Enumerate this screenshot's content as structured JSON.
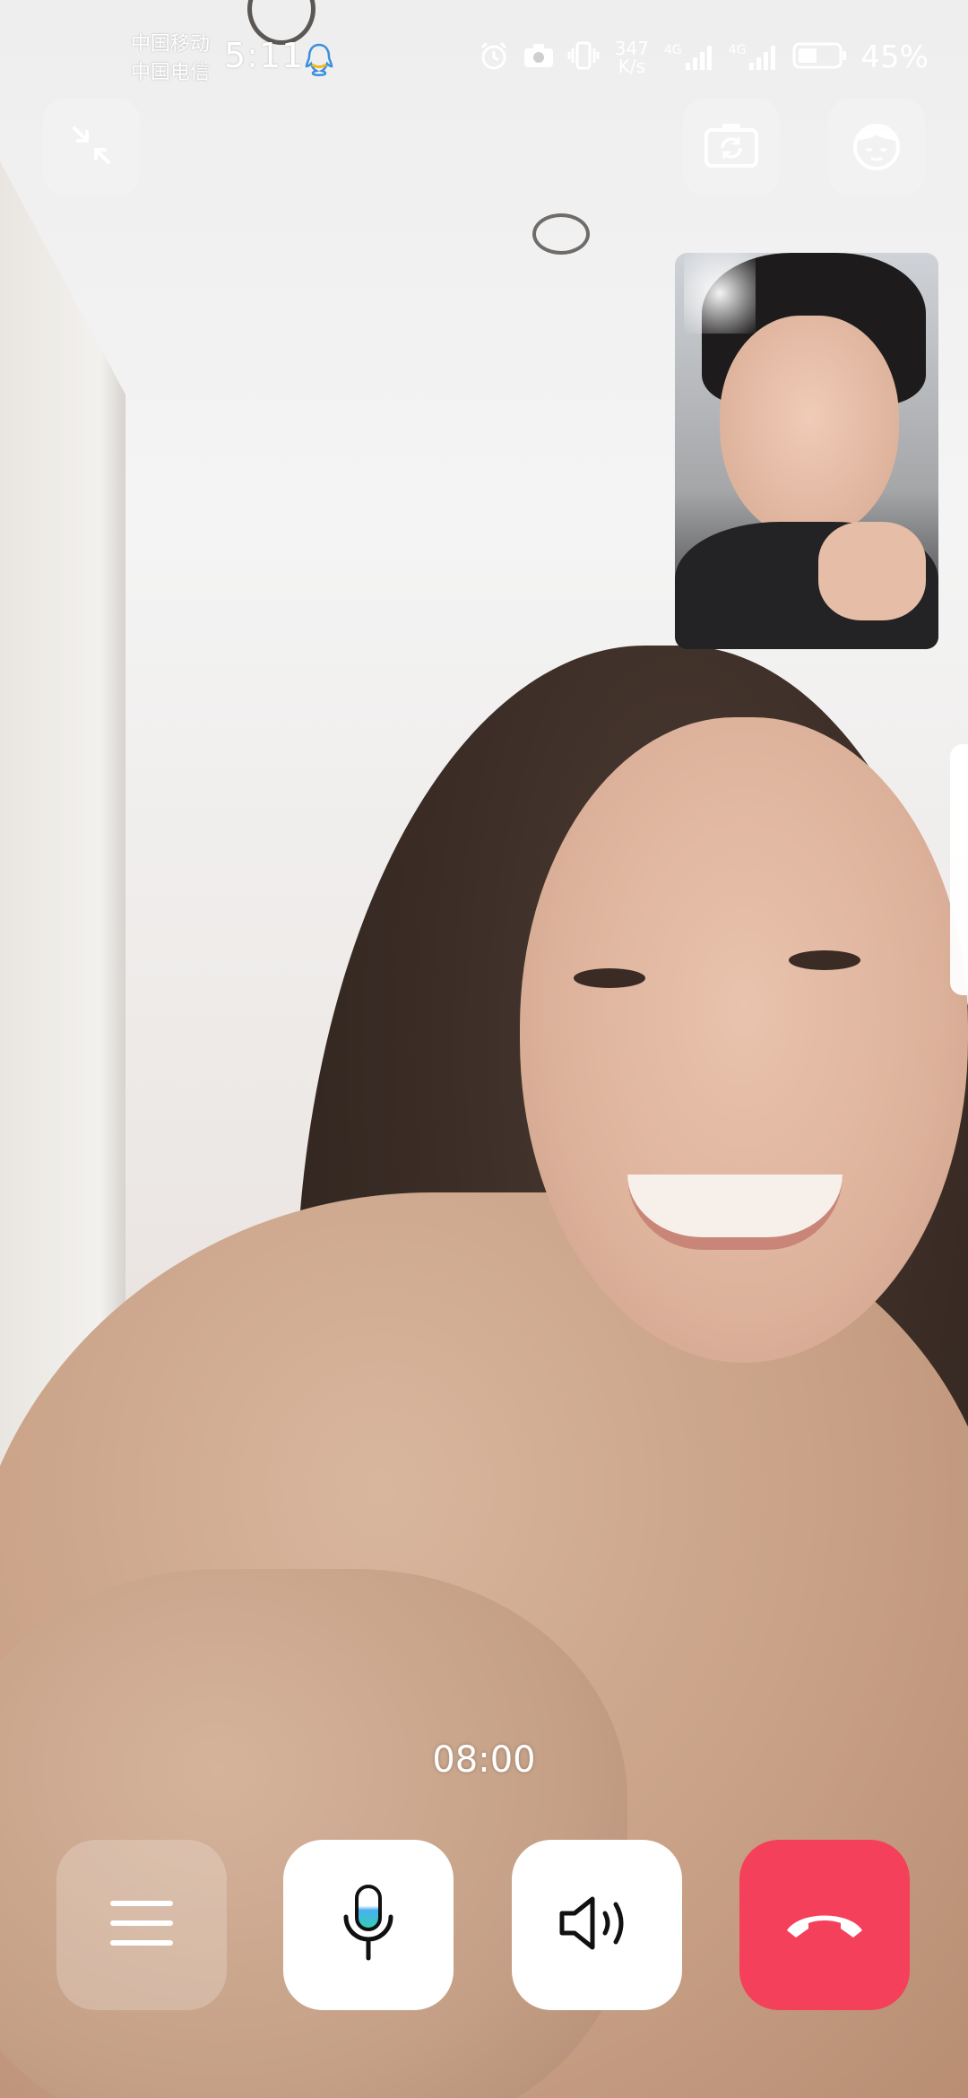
{
  "status_bar": {
    "carrier_1": "中国移动",
    "carrier_2": "中国电信",
    "time": "5:11",
    "net_speed_value": "347",
    "net_speed_unit": "K/s",
    "network_1": "4G",
    "network_2": "4G",
    "battery_percent": "45%",
    "icons": [
      "qq-notification-icon",
      "alarm-icon",
      "camera-icon",
      "vibrate-icon",
      "signal-icon",
      "signal-icon",
      "battery-icon"
    ]
  },
  "call": {
    "timer": "08:00",
    "top_controls": [
      "minimize-icon",
      "switch-camera-icon",
      "beauty-filter-icon"
    ],
    "bottom_controls": [
      "menu-icon",
      "microphone-icon",
      "speaker-icon",
      "hang-up-icon"
    ],
    "colors": {
      "hangup": "#f5405b",
      "mic_accent": "#4ab0f0"
    }
  }
}
